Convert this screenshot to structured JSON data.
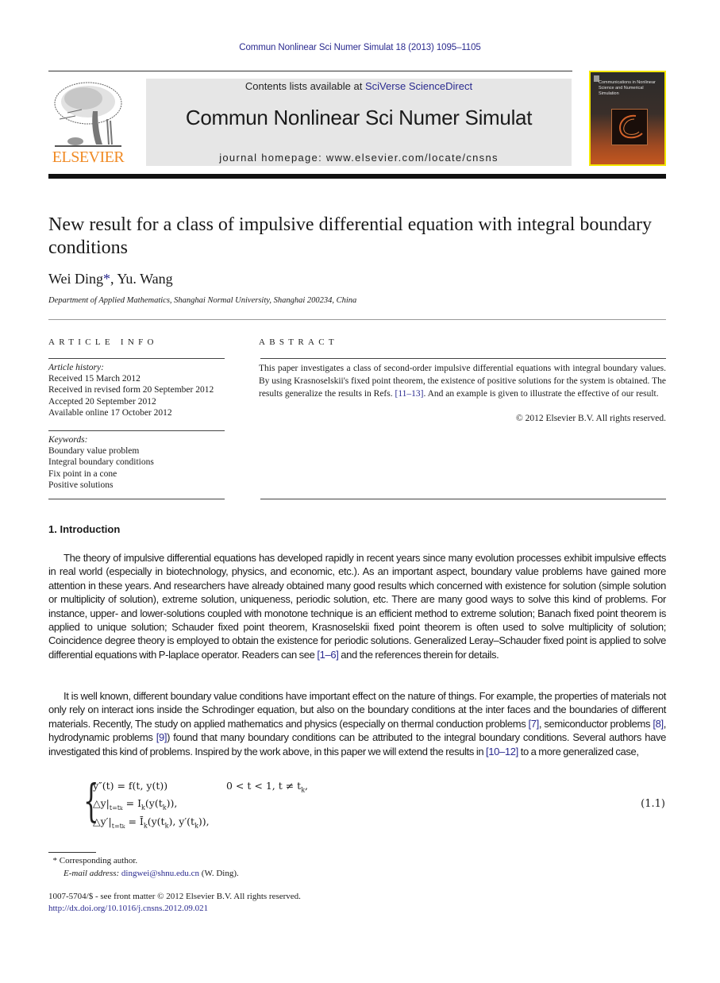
{
  "running_head": "Commun Nonlinear Sci Numer Simulat 18 (2013) 1095–1105",
  "publisher": {
    "logo_word": "ELSEVIER",
    "brand_color": "#f08a24"
  },
  "banner": {
    "contents_prefix": "Contents lists available at ",
    "contents_link": "SciVerse ScienceDirect",
    "journal_title": "Commun Nonlinear Sci Numer Simulat",
    "homepage": "journal homepage: www.elsevier.com/locate/cnsns"
  },
  "cover": {
    "title": "Communications in Nonlinear Science and Numerical Simulation"
  },
  "article": {
    "title": "New result for a class of impulsive differential equation with integral boundary conditions",
    "authors": [
      {
        "name": "Wei Ding",
        "mark": "*"
      },
      {
        "name": "Yu. Wang"
      }
    ],
    "author_sep": ", ",
    "affiliation": "Department of Applied Mathematics, Shanghai Normal University, Shanghai 200234, China"
  },
  "article_info": {
    "heading": "ARTICLE INFO",
    "history_label": "Article history:",
    "history": [
      "Received 15 March 2012",
      "Received in revised form 20 September 2012",
      "Accepted 20 September 2012",
      "Available online 17 October 2012"
    ],
    "keywords_label": "Keywords:",
    "keywords": [
      "Boundary value problem",
      "Integral boundary conditions",
      "Fix point in a cone",
      "Positive solutions"
    ]
  },
  "abstract": {
    "heading": "ABSTRACT",
    "text_1": "This paper investigates a class of second-order impulsive differential equations with integral boundary values. By using Krasnoselskii's fixed point theorem, the existence of positive solutions for the system is obtained. The results generalize the results in Refs. ",
    "ref": "[11–13]",
    "text_2": ". And an example is given to illustrate the effective of our result.",
    "copyright": "© 2012 Elsevier B.V. All rights reserved."
  },
  "introduction": {
    "heading": "1. Introduction",
    "para1_a": "The theory of impulsive differential equations has developed rapidly in recent years since many evolution processes exhibit impulsive effects in real world (especially in biotechnology, physics, and economic, etc.). As an important aspect, boundary value problems have gained more attention in these years. And researchers have already obtained many good results which concerned with existence for solution (simple solution or multiplicity of solution), extreme solution, uniqueness, periodic solution, etc. There are many good ways to solve this kind of problems. For instance, upper- and lower-solutions coupled with monotone technique is an efficient method to extreme solution; Banach fixed point theorem is applied to unique solution; Schauder fixed point theorem, Krasnoselskii fixed point theorem is often used to solve multiplicity of solution; Coincidence degree theory is employed to obtain the existence for periodic solutions. Generalized Leray–Schauder fixed point is applied to solve differential equations with P-laplace operator. Readers can see ",
    "para1_ref": "[1–6]",
    "para1_b": " and the references therein for details.",
    "para2_a": "It is well known, different boundary value conditions have important effect on the nature of things. For example, the properties of materials not only rely on interact ions inside the Schrodinger equation, but also on the boundary conditions at the inter faces and the boundaries of different materials. Recently, The study on applied mathematics and physics (especially on thermal conduction problems ",
    "ref7": "[7]",
    "para2_b": ", semiconductor problems ",
    "ref8": "[8]",
    "para2_c": ", hydrodynamic problems ",
    "ref9": "[9]",
    "para2_d": ") found that many boundary conditions can be attributed to the integral boundary conditions. Several authors have investigated this kind of problems. Inspired by the work above, in this paper we will extend the results in ",
    "ref10": "[10–12]",
    "para2_e": " to a more generalized case,"
  },
  "equation": {
    "number": "(1.1)",
    "line1": "y″(t) = f(t, y(t))",
    "line1_cond": "0 < t < 1,  t ≠ t",
    "line1_cond_sub": "k",
    "line1_cond_end": ",",
    "line2_a": "△y|",
    "line2_sub": "t=t",
    "line2_subsub": "k",
    "line2_b": " = I",
    "line2_b_sub": "k",
    "line2_c": "(y(t",
    "line2_c_sub": "k",
    "line2_d": ")),",
    "line3_a": "△y′|",
    "line3_b": " = Ī",
    "line3_c": "(y(t",
    "line3_d": "), y′(t",
    "line3_e": ")),"
  },
  "footnotes": {
    "mark": "*",
    "corresponding": "Corresponding author.",
    "email_label": "E-mail address:",
    "email": "dingwei@shnu.edu.cn",
    "email_suffix": " (W. Ding)."
  },
  "bottom": {
    "issn_line": "1007-5704/$ - see front matter © 2012 Elsevier B.V. All rights reserved.",
    "doi": "http://dx.doi.org/10.1016/j.cnsns.2012.09.021"
  }
}
